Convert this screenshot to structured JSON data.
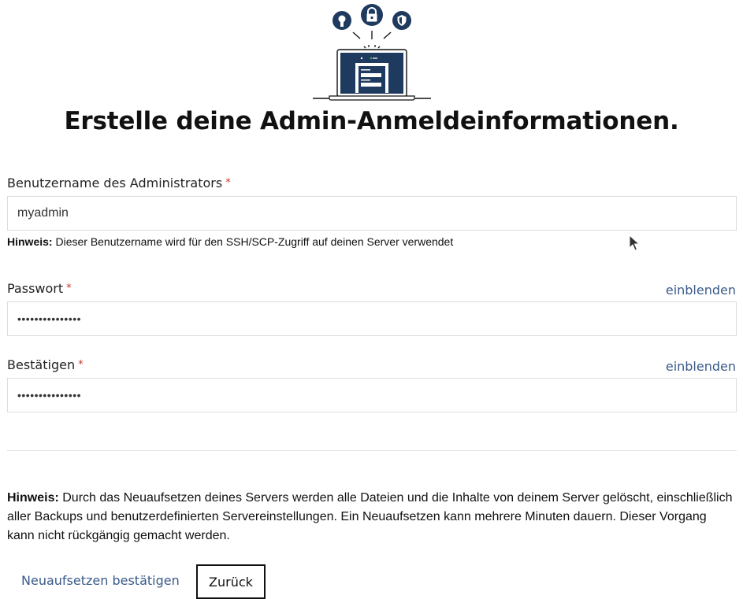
{
  "page": {
    "title": "Erstelle deine Admin-Anmeldeinformationen."
  },
  "username": {
    "label": "Benutzername des Administrators",
    "required_mark": "*",
    "value": "myadmin",
    "hint_prefix": "Hinweis:",
    "hint_text": " Dieser Benutzername wird für den SSH/SCP-Zugriff auf deinen Server verwendet"
  },
  "password": {
    "label": "Passwort",
    "required_mark": "*",
    "value": "passwortpasswor",
    "toggle_label": "einblenden"
  },
  "confirm": {
    "label": "Bestätigen",
    "required_mark": "*",
    "value": "passwortpasswor",
    "toggle_label": "einblenden"
  },
  "notice": {
    "prefix": "Hinweis:",
    "text": " Durch das Neuaufsetzen deines Servers werden alle Dateien und die Inhalte von deinem Server gelöscht, einschließlich aller Backups und benutzerdefinierten Servereinstellungen. Ein Neuaufsetzen kann mehrere Minuten dauern. Dieser Vorgang kann nicht rückgängig gemacht werden."
  },
  "actions": {
    "confirm_label": "Neuaufsetzen bestätigen",
    "back_label": "Zurück"
  },
  "colors": {
    "accent_link": "#3a5a8a",
    "illustration_navy": "#1f3a5f",
    "required": "#c0392b"
  },
  "icons": [
    "award-icon",
    "lock-icon",
    "shield-icon",
    "laptop-login-illustration",
    "mouse-cursor-icon"
  ]
}
